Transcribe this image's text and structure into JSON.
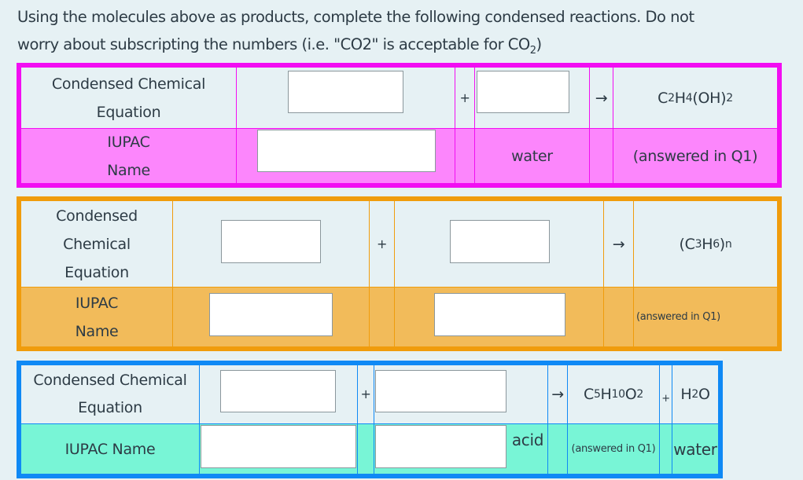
{
  "instructions": {
    "line1": "Using the molecules above as products, complete the following condensed reactions.  Do not",
    "line2_pre": "worry about subscripting the numbers (i.e. \"CO2\" is acceptable for CO",
    "line2_sub": "2",
    "line2_post": ")"
  },
  "tables": [
    {
      "border_color": "#f20ef2",
      "row2_color": "#fc86fc",
      "row1_label": "Condensed Chemical Equation",
      "row2_label_line1": "IUPAC",
      "row2_label_line2": "Name",
      "plus": "+",
      "arrow": "→",
      "product_formula": {
        "parts": [
          "C",
          "2",
          "H",
          "4",
          "(OH)",
          "2"
        ]
      },
      "reactant1_value": "",
      "reactant2_value": "",
      "reactant1_name_value": "",
      "reactant2_name_text": "water",
      "product_name": "(answered in Q1)"
    },
    {
      "border_color": "#f09c0c",
      "row2_color": "#f2bb5a",
      "row1_label_line1": "Condensed",
      "row1_label_line2": "Chemical",
      "row1_label_line3": "Equation",
      "row2_label_line1": "IUPAC",
      "row2_label_line2": "Name",
      "plus": "+",
      "arrow": "→",
      "product_formula": {
        "parts": [
          "(C",
          "3",
          "H",
          "6",
          ")",
          "n"
        ]
      },
      "reactant1_value": "",
      "reactant2_value": "",
      "reactant1_name_value": "",
      "reactant2_name_value": "",
      "product_name": "(answered in Q1)"
    },
    {
      "border_color": "#0f89f5",
      "row2_color": "#78f5d6",
      "row1_label_line1": "Condensed Chemical",
      "row1_label_line2": "Equation",
      "row2_label": "IUPAC Name",
      "plus": "+",
      "arrow": "→",
      "product_formula": {
        "parts": [
          "C",
          "5",
          "H",
          "10",
          "O",
          "2"
        ]
      },
      "plus2": "+",
      "product2_formula": {
        "parts": [
          "H",
          "2",
          "O"
        ]
      },
      "reactant1_value": "",
      "reactant2_value": "",
      "reactant1_name_value": "",
      "reactant2_name_value": "",
      "reactant2_name_suffix": "acid",
      "product_name": "(answered in Q1)",
      "product2_name": "water"
    }
  ]
}
